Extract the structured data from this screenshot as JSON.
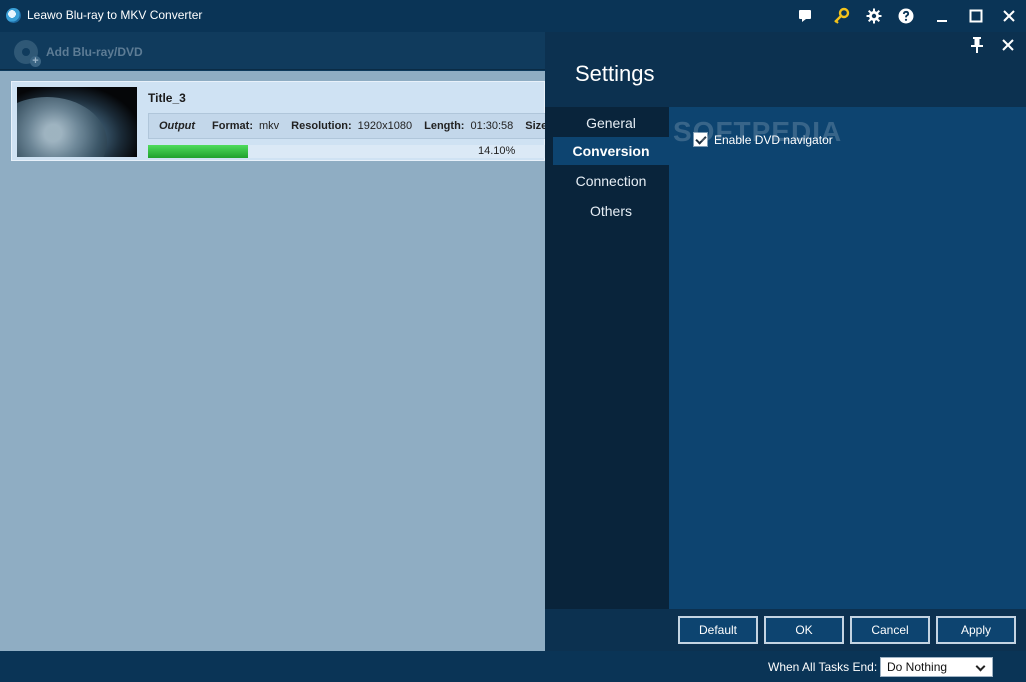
{
  "window": {
    "title": "Leawo Blu-ray to MKV Converter",
    "icons": [
      "app-icon",
      "chat-icon",
      "key-icon",
      "gear-icon",
      "help-icon",
      "minimize-icon",
      "maximize-icon",
      "close-icon"
    ]
  },
  "toolbar": {
    "add_label": "Add Blu-ray/DVD"
  },
  "task": {
    "title": "Title_3",
    "output_label": "Output",
    "format_label": "Format:",
    "format_value": "mkv",
    "resolution_label": "Resolution:",
    "resolution_value": "1920x1080",
    "length_label": "Length:",
    "length_value": "01:30:58",
    "size_label": "Size:",
    "progress_text": "14.10%",
    "progress_fraction": 0.25
  },
  "settings": {
    "title": "Settings",
    "nav": [
      {
        "label": "General",
        "active": false
      },
      {
        "label": "Conversion",
        "active": true
      },
      {
        "label": "Connection",
        "active": false
      },
      {
        "label": "Others",
        "active": false
      }
    ],
    "enable_dvd_navigator_label": "Enable DVD navigator",
    "enable_dvd_navigator_checked": true,
    "watermark": "SOFTPEDIA",
    "buttons": {
      "default": "Default",
      "ok": "OK",
      "cancel": "Cancel",
      "apply": "Apply"
    }
  },
  "statusbar": {
    "label": "When All Tasks End:",
    "selected": "Do Nothing"
  },
  "colors": {
    "titlebar": "#0a3456",
    "list_bg": "#8fadc3",
    "settings_content": "#0d4470",
    "progress_green": "#1fa12d",
    "key_icon": "#f3c21b"
  }
}
